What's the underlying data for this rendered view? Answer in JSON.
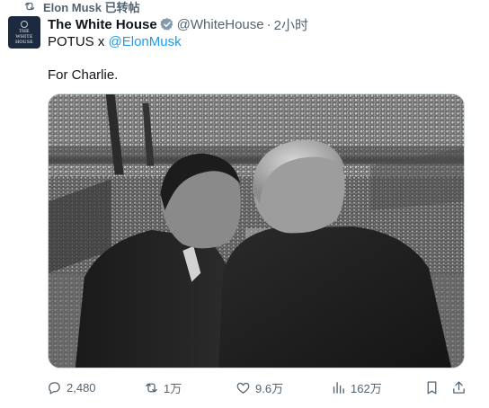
{
  "repost_banner": {
    "text": "Elon Musk 已转帖",
    "icon": "repost-icon"
  },
  "avatar": {
    "lines": [
      "THE",
      "WHITE",
      "HOUSE"
    ]
  },
  "post": {
    "author_name": "The White House",
    "handle": "@WhiteHouse",
    "separator": "·",
    "time": "2小时",
    "subtitle_prefix": "POTUS x ",
    "subtitle_mention": "@ElonMusk",
    "text": "For Charlie."
  },
  "actions": {
    "replies": "2,480",
    "reposts": "1万",
    "likes": "9.6万",
    "views": "162万"
  },
  "colors": {
    "accent": "#1d9bf0",
    "muted": "#536471",
    "text": "#0f1419"
  }
}
